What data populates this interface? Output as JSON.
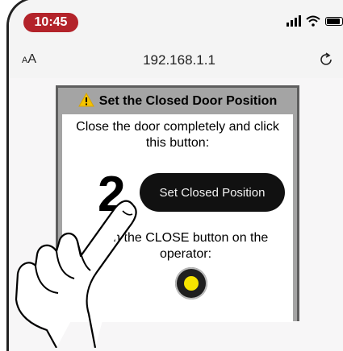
{
  "status_bar": {
    "time": "10:45",
    "icons": [
      "signal-icon",
      "wifi-icon",
      "battery-icon"
    ]
  },
  "address_bar": {
    "text_size_label": "AA",
    "url": "192.168.1.1",
    "reload_icon": "reload-icon"
  },
  "panel": {
    "heading": "Set the Closed Door Position",
    "heading_icon": "warning-icon",
    "instruction": "Close the door completely and click this button:",
    "step_number": "2",
    "button_label": "Set Closed Position",
    "instruction_2": "n the CLOSE button on the operator:",
    "instruction_2_prefix": "O"
  },
  "colors": {
    "time_pill": "#b3232a",
    "button": "#111111",
    "led": "#f7e400",
    "panel_frame": "#a4a4a4"
  }
}
